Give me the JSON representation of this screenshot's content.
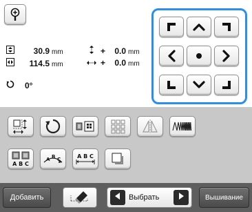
{
  "size": {
    "height_value": "30.9",
    "width_value": "114.5",
    "unit": "mm"
  },
  "offset": {
    "vertical_sign": "+",
    "vertical_value": "0.0",
    "horizontal_sign": "+",
    "horizontal_value": "0.0",
    "unit": "mm"
  },
  "rotation": {
    "value": "0°"
  },
  "colors": {
    "accent": "#2a8ef0",
    "toolbar_bg": "#c8c8c8",
    "bottom_bar_bg": "#5e5e5e"
  },
  "tools": {
    "row1": [
      "resize-icon",
      "rotate-icon",
      "layout-icon",
      "array-icon",
      "mirror-icon",
      "density-icon"
    ],
    "row2": [
      "spacing-icon",
      "arc-text-icon",
      "letter-spacing-icon",
      "border-frame-icon"
    ]
  },
  "bottom_bar": {
    "add_label": "Добавить",
    "select_label": "Выбрать",
    "embroider_label": "Вышивание"
  }
}
